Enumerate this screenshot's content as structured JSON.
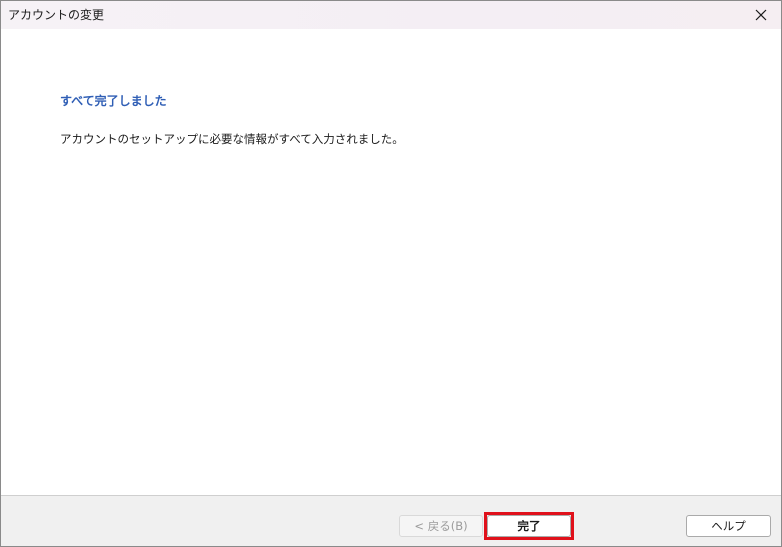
{
  "window": {
    "title": "アカウントの変更"
  },
  "content": {
    "heading": "すべて完了しました",
    "message": "アカウントのセットアップに必要な情報がすべて入力されました。"
  },
  "footer": {
    "back_label": "< 戻る(B)",
    "finish_label": "完了",
    "help_label": "ヘルプ"
  },
  "colors": {
    "heading": "#2f5eb5",
    "highlight": "#e0111b"
  }
}
